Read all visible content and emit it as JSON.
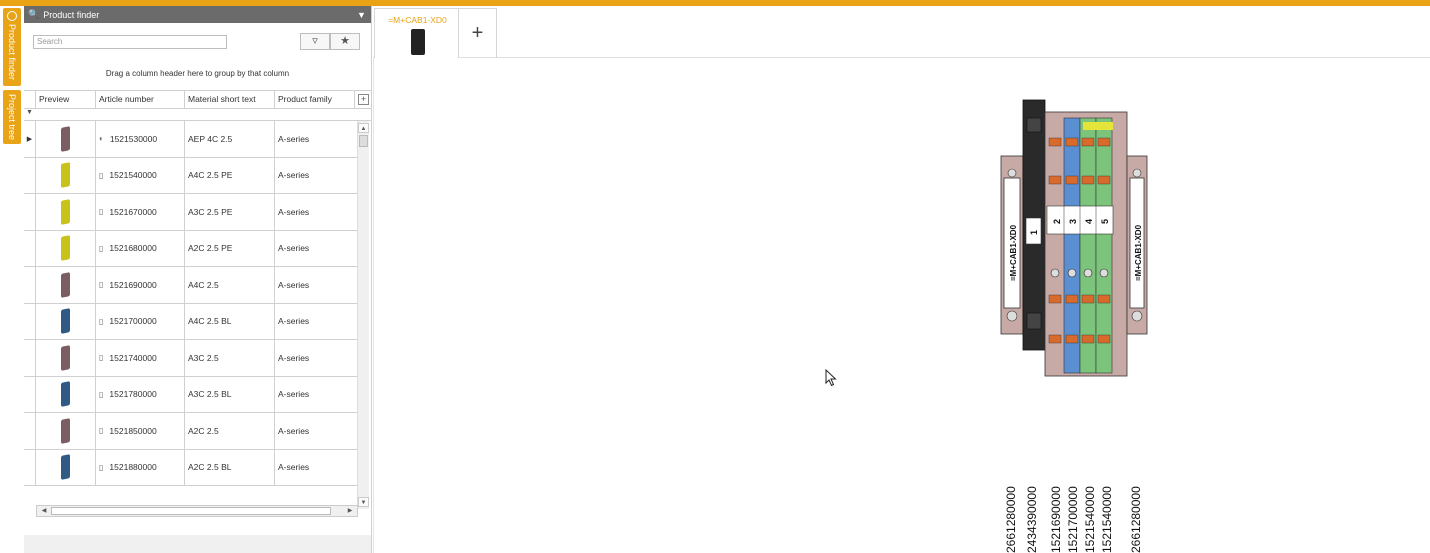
{
  "colors": {
    "accent": "#e8a317",
    "panel_header": "#6b6b6b"
  },
  "sidebar_tabs": [
    "Product finder",
    "Project tree"
  ],
  "panel": {
    "title": "Product finder",
    "search_placeholder": "Search",
    "group_hint": "Drag a column header here to group by that column",
    "columns": [
      "Preview",
      "Article number",
      "Material short text",
      "Product family"
    ],
    "rows": [
      {
        "article": "1521530000",
        "text": "AEP 4C 2.5",
        "family": "A-series",
        "color": "#7a5e62",
        "icon": "view-icon"
      },
      {
        "article": "1521540000",
        "text": "A4C 2.5 PE",
        "family": "A-series",
        "color": "#c8c21a",
        "icon": "doc-icon"
      },
      {
        "article": "1521670000",
        "text": "A3C 2.5 PE",
        "family": "A-series",
        "color": "#c8c21a",
        "icon": "doc-icon"
      },
      {
        "article": "1521680000",
        "text": "A2C 2.5 PE",
        "family": "A-series",
        "color": "#c8c21a",
        "icon": "doc-icon"
      },
      {
        "article": "1521690000",
        "text": "A4C 2.5",
        "family": "A-series",
        "color": "#7a5e62",
        "icon": "doc-icon"
      },
      {
        "article": "1521700000",
        "text": "A4C 2.5 BL",
        "family": "A-series",
        "color": "#2f5a86",
        "icon": "doc-icon"
      },
      {
        "article": "1521740000",
        "text": "A3C 2.5",
        "family": "A-series",
        "color": "#7a5e62",
        "icon": "doc-icon"
      },
      {
        "article": "1521780000",
        "text": "A3C 2.5 BL",
        "family": "A-series",
        "color": "#2f5a86",
        "icon": "doc-icon"
      },
      {
        "article": "1521850000",
        "text": "A2C 2.5",
        "family": "A-series",
        "color": "#7a5e62",
        "icon": "doc-icon"
      },
      {
        "article": "1521880000",
        "text": "A2C 2.5 BL",
        "family": "A-series",
        "color": "#2f5a86",
        "icon": "doc-icon"
      }
    ]
  },
  "document_tab": {
    "label": "=M+CAB1-XD0",
    "add_label": "+"
  },
  "terminal": {
    "end_label": "=M+CAB1-XD0",
    "numbers": [
      "1",
      "2",
      "3",
      "4",
      "5"
    ]
  },
  "article_labels": [
    "2661280000",
    "2434390000",
    "1521690000",
    "1521700000",
    "1521540000",
    "1521540000",
    "2661280000"
  ]
}
